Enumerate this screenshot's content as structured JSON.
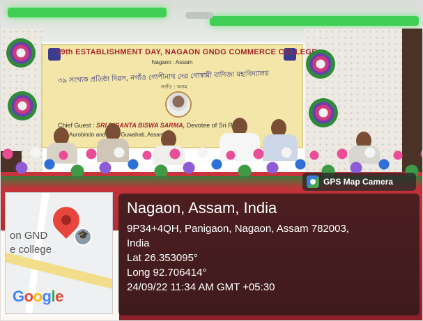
{
  "banner": {
    "title": "39th ESTABLISHMENT DAY, NAGAON GNDG COMMERCE COLLEGE",
    "subtitle": "Nagaon : Assam",
    "assamese_line": "৩৯ সংখ্যক প্ৰতিষ্ঠা দিৱস, নগাঁও গোপীনাথ দেৱ গোস্বামী বাণিজ্য মহাবিদ্যালয়",
    "assamese_place": "নগাঁও : অসম",
    "chief_guest_prefix": "Chief Guest :",
    "chief_guest_name": "SRI DIGANTA BISWA SARMA,",
    "chief_guest_suffix": "Devotee of Sri Ry...",
    "chief_line2": "& ... Aurobindo and ... or, Guwahati, Assam"
  },
  "gps_tag": {
    "label": "GPS Map Camera",
    "icon": "gps-camera-app-icon"
  },
  "location": {
    "place": "Nagaon, Assam, India",
    "address_line1": "9P34+4QH, Panigaon, Nagaon, Assam 782003,",
    "address_line2": "India",
    "lat": "Lat 26.353095°",
    "long": "Long 92.706414°",
    "datetime": "24/09/22 11:34 AM GMT +05:30"
  },
  "map": {
    "label_line1": "on GND",
    "label_line2": "e college",
    "google_letters": [
      "G",
      "o",
      "o",
      "g",
      "l",
      "e"
    ],
    "pin_icon": "red-location-pin-icon",
    "poi_icon": "graduation-cap-icon"
  },
  "colors": {
    "banner_bg": "#f3e6a8",
    "banner_title": "#a8262a",
    "table_red": "#c9343a",
    "overlay_bg": "rgba(32,24,24,.72)",
    "ceiling_light": "#3fcf55"
  }
}
